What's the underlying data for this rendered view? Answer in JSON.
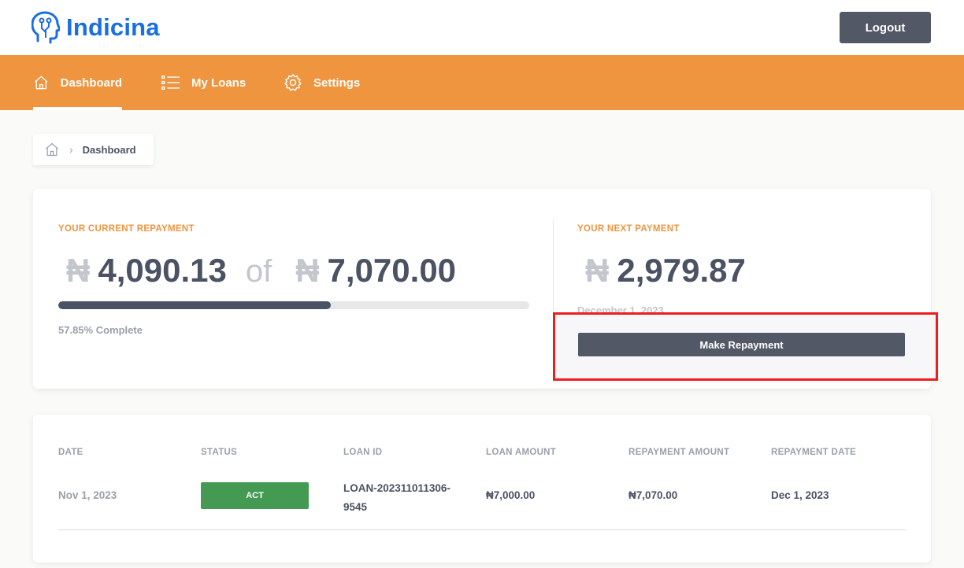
{
  "brand": {
    "name": "Indicina",
    "color": "#1a6fe0"
  },
  "header": {
    "logout_label": "Logout"
  },
  "nav": {
    "accent": "#ef943f",
    "items": [
      {
        "label": "Dashboard",
        "icon": "home-icon",
        "active": true
      },
      {
        "label": "My Loans",
        "icon": "list-icon",
        "active": false
      },
      {
        "label": "Settings",
        "icon": "gear-icon",
        "active": false
      }
    ]
  },
  "breadcrumb": {
    "separator": "›",
    "current": "Dashboard"
  },
  "current_repayment": {
    "label": "YOUR CURRENT REPAYMENT",
    "currency_symbol": "₦",
    "paid": "4,090.13",
    "of_word": "of",
    "total": "7,070.00",
    "progress_fraction": 0.5785,
    "complete_text": "57.85% Complete"
  },
  "next_payment": {
    "label": "YOUR NEXT PAYMENT",
    "currency_symbol": "₦",
    "amount": "2,979.87",
    "date": "December 1, 2023",
    "button_label": "Make Repayment"
  },
  "loans_table": {
    "headers": [
      "DATE",
      "STATUS",
      "LOAN ID",
      "LOAN AMOUNT",
      "REPAYMENT AMOUNT",
      "REPAYMENT DATE"
    ],
    "rows": [
      {
        "date": "Nov 1, 2023",
        "status": "ACT",
        "status_color": "#449a52",
        "loan_id_line1": "LOAN-202311011306-",
        "loan_id_line2": "9545",
        "loan_amount": "₦7,000.00",
        "repayment_amount": "₦7,070.00",
        "repayment_date": "Dec 1, 2023"
      }
    ]
  }
}
